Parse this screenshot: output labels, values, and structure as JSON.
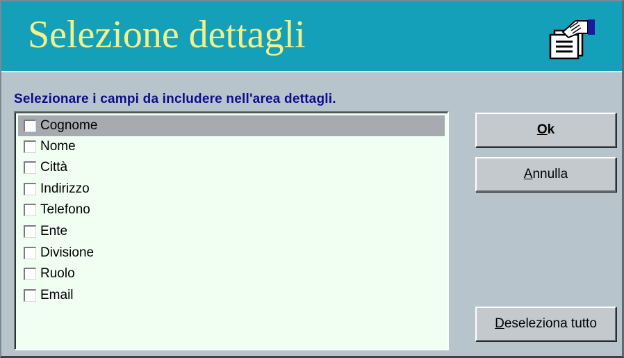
{
  "dialog": {
    "title": "Selezione dettagli",
    "header_icon": "document-hand-icon",
    "instructions": "Selezionare i campi da includere nell'area dettagli."
  },
  "fields": [
    {
      "label": "Cognome",
      "checked": false,
      "selected": true
    },
    {
      "label": "Nome",
      "checked": false,
      "selected": false
    },
    {
      "label": "Città",
      "checked": false,
      "selected": false
    },
    {
      "label": "Indirizzo",
      "checked": false,
      "selected": false
    },
    {
      "label": "Telefono",
      "checked": false,
      "selected": false
    },
    {
      "label": "Ente",
      "checked": false,
      "selected": false
    },
    {
      "label": "Divisione",
      "checked": false,
      "selected": false
    },
    {
      "label": "Ruolo",
      "checked": false,
      "selected": false
    },
    {
      "label": "Email",
      "checked": false,
      "selected": false
    }
  ],
  "buttons": {
    "ok": {
      "mnemonic": "O",
      "rest": "k"
    },
    "cancel": {
      "mnemonic": "A",
      "rest": "nnulla"
    },
    "deselect_all": {
      "mnemonic": "D",
      "rest": "eseleziona tutto"
    }
  },
  "colors": {
    "header_bg": "#14a0b8",
    "title_text": "#f2f08a",
    "instruction_text": "#0c0c8a",
    "list_bg": "#f0fff2",
    "selection_bg": "#a7aaae",
    "dialog_bg": "#b8c4cb"
  }
}
